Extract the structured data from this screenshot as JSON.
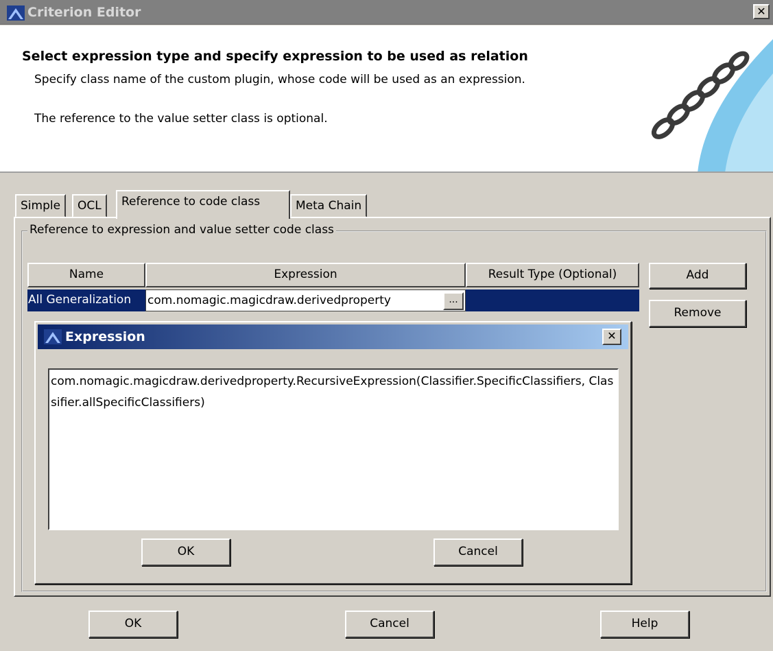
{
  "window": {
    "title": "Criterion Editor",
    "close": "✕"
  },
  "banner": {
    "heading": "Select expression type and specify expression to be used as relation",
    "line1": "Specify class name of the custom plugin, whose code will be used as an expression.",
    "line2": "The reference to the value setter class is optional."
  },
  "tabs": [
    {
      "label": "Simple"
    },
    {
      "label": "OCL"
    },
    {
      "label": "Reference to code class"
    },
    {
      "label": "Meta Chain"
    }
  ],
  "active_tab": "Reference to code class",
  "group": {
    "legend": "Reference to expression and value setter code class"
  },
  "table": {
    "headers": [
      "Name",
      "Expression",
      "Result Type (Optional)"
    ],
    "rows": [
      {
        "name": "All Generalization",
        "expression": "com.nomagic.magicdraw.derivedproperty",
        "result_type": ""
      }
    ],
    "ellipsis": "..."
  },
  "side_buttons": {
    "add": "Add",
    "remove": "Remove"
  },
  "expression_dialog": {
    "title": "Expression",
    "close": "✕",
    "text": "com.nomagic.magicdraw.derivedproperty.RecursiveExpression(Classifier.SpecificClassifiers, Classifier.allSpecificClassifiers)",
    "ok": "OK",
    "cancel": "Cancel"
  },
  "footer": {
    "ok": "OK",
    "cancel": "Cancel",
    "help": "Help"
  },
  "colors": {
    "selection": "#0a246a",
    "face": "#d4d0c8",
    "title_gradient_end": "#a6caf0"
  }
}
